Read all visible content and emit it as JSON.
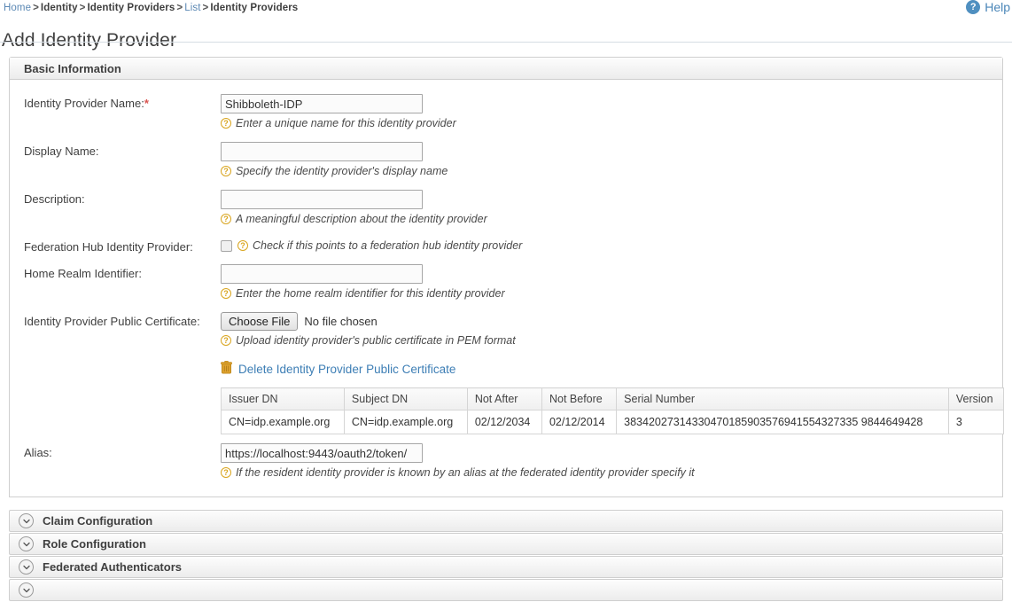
{
  "breadcrumb": {
    "items": [
      {
        "label": "Home",
        "link": true
      },
      {
        "label": "Identity",
        "link": false
      },
      {
        "label": "Identity Providers",
        "link": false
      },
      {
        "label": "List",
        "link": true
      },
      {
        "label": "Identity Providers",
        "link": false
      }
    ],
    "separator": ">"
  },
  "help": {
    "label": "Help",
    "icon": "question-circle-icon"
  },
  "page": {
    "title": "Add Identity Provider"
  },
  "panel": {
    "title": "Basic Information"
  },
  "form": {
    "idp_name": {
      "label": "Identity Provider Name:",
      "required_marker": "*",
      "value": "Shibboleth-IDP",
      "placeholder": "",
      "hint": "Enter a unique name for this identity provider"
    },
    "display_name": {
      "label": "Display Name:",
      "value": "",
      "placeholder": "",
      "hint": "Specify the identity provider's display name"
    },
    "description": {
      "label": "Description:",
      "value": "",
      "placeholder": "",
      "hint": "A meaningful description about the identity provider"
    },
    "federation_hub": {
      "label": "Federation Hub Identity Provider:",
      "checked": false,
      "hint": "Check if this points to a federation hub identity provider"
    },
    "home_realm": {
      "label": "Home Realm Identifier:",
      "value": "",
      "placeholder": "",
      "hint": "Enter the home realm identifier for this identity provider"
    },
    "certificate": {
      "label": "Identity Provider Public Certificate:",
      "choose_button": "Choose File",
      "file_status": "No file chosen",
      "hint": "Upload identity provider's public certificate in PEM format",
      "delete_link": "Delete Identity Provider Public Certificate",
      "delete_icon": "trash-icon"
    },
    "alias": {
      "label": "Alias:",
      "value": "https://localhost:9443/oauth2/token/",
      "placeholder": "",
      "hint": "If the resident identity provider is known by an alias at the federated identity provider specify it"
    }
  },
  "cert_table": {
    "columns": [
      "Issuer DN",
      "Subject DN",
      "Not After",
      "Not Before",
      "Serial Number",
      "Version"
    ],
    "rows": [
      {
        "issuer_dn": "CN=idp.example.org",
        "subject_dn": "CN=idp.example.org",
        "not_after": "02/12/2034",
        "not_before": "02/12/2014",
        "serial_number": "38342027314330470185903576941554327335 9844649428",
        "version": "3"
      }
    ]
  },
  "accordions": [
    {
      "label": "Claim Configuration",
      "icon": "chevron-down-icon",
      "expanded": false
    },
    {
      "label": "Role Configuration",
      "icon": "chevron-down-icon",
      "expanded": false
    },
    {
      "label": "Federated Authenticators",
      "icon": "chevron-down-icon",
      "expanded": false
    },
    {
      "label": "",
      "icon": "chevron-down-icon",
      "expanded": false
    }
  ],
  "colors": {
    "link": "#3d7eb5",
    "accent_hint": "#d9a51f",
    "required": "#d9534f",
    "help_blue": "#4f8fc0"
  }
}
